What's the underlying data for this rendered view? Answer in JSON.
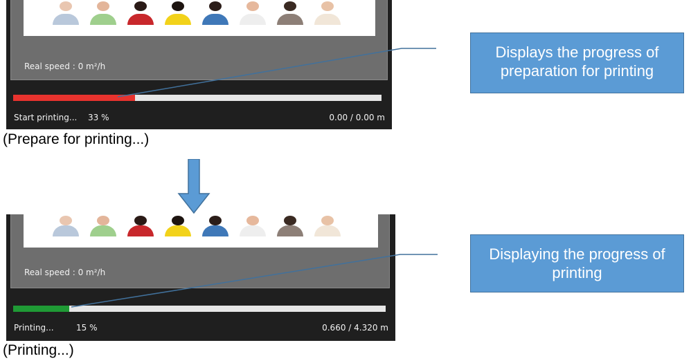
{
  "colors": {
    "panel_bg": "#1f1f1f",
    "preparation_fill": "#e8332e",
    "printing_fill": "#1f9a35",
    "callout_bg": "#5b9bd5",
    "arrow": "#5b9bd5",
    "leader_line": "#41719c"
  },
  "icons": {
    "down_arrow": "down-arrow-icon"
  },
  "preparation": {
    "speed_label": "Real speed : 0 m²/h",
    "status_label": "Start printing...",
    "progress_text": "33 %",
    "progress_percent": 33,
    "distance": "0.00 / 0.00 m",
    "caption": "(Prepare for printing...)",
    "callout": "Displays the progress of preparation for printing"
  },
  "printing": {
    "speed_label": "Real speed : 0 m²/h",
    "status_label": "Printing...",
    "progress_text": "15 %",
    "progress_percent": 15,
    "distance": "0.660 / 4.320 m",
    "caption": "(Printing...)",
    "callout": "Displaying the progress of printing"
  }
}
